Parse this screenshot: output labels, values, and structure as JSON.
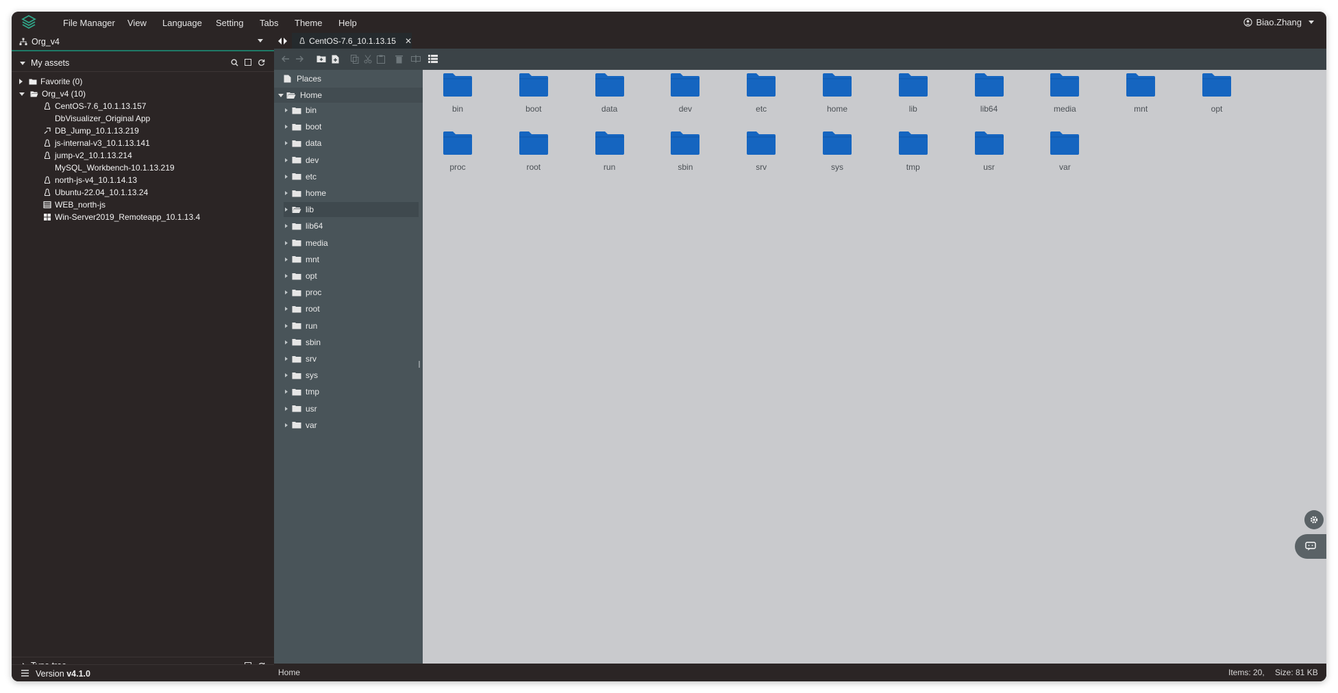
{
  "menubar": {
    "items": [
      "File Manager",
      "View",
      "Language",
      "Setting",
      "Tabs",
      "Theme",
      "Help"
    ],
    "user": "Biao.Zhang"
  },
  "left": {
    "org": "Org_v4",
    "assets_title": "My assets",
    "tree": [
      {
        "label": "Favorite (0)",
        "icon": "folder-icon"
      },
      {
        "label": "Org_v4 (10)",
        "icon": "folder-open-icon"
      },
      {
        "label": "CentOS-7.6_10.1.13.157",
        "icon": "linux-icon"
      },
      {
        "label": "DbVisualizer_Original App",
        "icon": ""
      },
      {
        "label": "DB_Jump_10.1.13.219",
        "icon": "link-icon"
      },
      {
        "label": "js-internal-v3_10.1.13.141",
        "icon": "linux-icon"
      },
      {
        "label": "jump-v2_10.1.13.214",
        "icon": "linux-icon"
      },
      {
        "label": "MySQL_Workbench-10.1.13.219",
        "icon": ""
      },
      {
        "label": "north-js-v4_10.1.14.13",
        "icon": "linux-icon"
      },
      {
        "label": "Ubuntu-22.04_10.1.13.24",
        "icon": "linux-icon"
      },
      {
        "label": "WEB_north-js",
        "icon": "web-icon"
      },
      {
        "label": "Win-Server2019_Remoteapp_10.1.13.4",
        "icon": "windows-icon"
      }
    ],
    "type_tree": "Type tree",
    "version_label": "Version",
    "version_value": "v4.1.0"
  },
  "tab": {
    "label": "CentOS-7.6_10.1.13.15̷",
    "label_clean": "CentOS-7.6_10.1.13.15"
  },
  "ftree": {
    "places": "Places",
    "home": "Home",
    "folders": [
      "bin",
      "boot",
      "data",
      "dev",
      "etc",
      "home",
      "lib",
      "lib64",
      "media",
      "mnt",
      "opt",
      "proc",
      "root",
      "run",
      "sbin",
      "srv",
      "sys",
      "tmp",
      "usr",
      "var"
    ]
  },
  "files": {
    "row1": [
      "bin",
      "boot",
      "data",
      "dev",
      "etc",
      "home",
      "lib",
      "lib64",
      "media",
      "mnt",
      "opt"
    ],
    "row2": [
      "proc",
      "root",
      "run",
      "sbin",
      "srv",
      "sys",
      "tmp",
      "usr",
      "var"
    ]
  },
  "status": {
    "path": "Home",
    "items": "Items: 20,",
    "size": "Size: 81 KB"
  },
  "colors": {
    "accent": "#1f7a67",
    "folder_blue": "#1565c0",
    "panel_dark": "#2b2525",
    "tree_bg": "#495459",
    "files_bg": "#c9cacd"
  }
}
